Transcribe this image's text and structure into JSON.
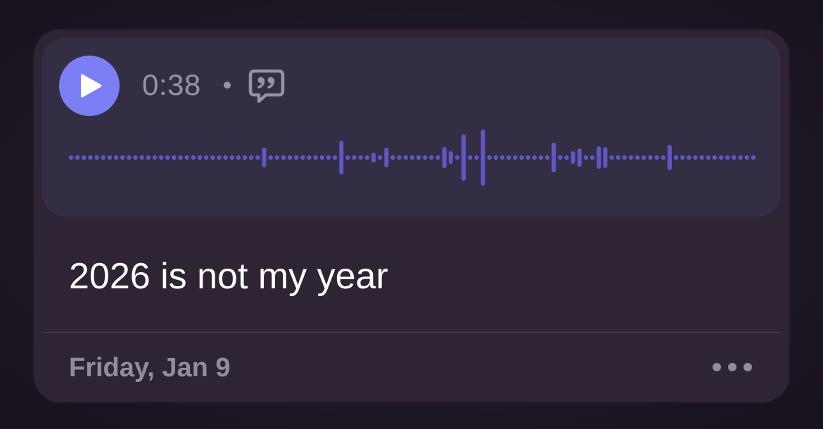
{
  "player": {
    "duration": "0:38",
    "separator": "•",
    "play_icon": "play-icon",
    "transcript_icon": "quote-bubble-icon",
    "accent_color": "#7c7ff4",
    "waveform_color": "#5f58c4"
  },
  "memo": {
    "title": "2026 is not my year",
    "date": "Friday, Jan 9",
    "more_icon": "ellipsis-icon"
  }
}
